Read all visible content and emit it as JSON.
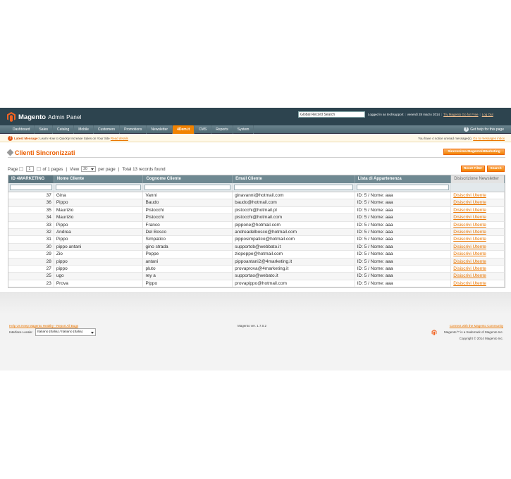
{
  "header": {
    "brand": "Magento",
    "subtitle": "Admin Panel",
    "search_value": "Global Record Search",
    "logged_in": "Logged in as techsupport",
    "date": "venerdì 28 marzo 2014",
    "try_go": "Try Magento Go for Free",
    "logout": "Log Out"
  },
  "nav": {
    "items": [
      {
        "label": "Dashboard"
      },
      {
        "label": "Sales"
      },
      {
        "label": "Catalog"
      },
      {
        "label": "Mobile"
      },
      {
        "label": "Customers"
      },
      {
        "label": "Promotions"
      },
      {
        "label": "Newsletter"
      },
      {
        "label": "4Dem.it"
      },
      {
        "label": "CMS"
      },
      {
        "label": "Reports"
      },
      {
        "label": "System"
      }
    ],
    "active_index": 7,
    "help": "Get help for this page"
  },
  "notice": {
    "latest_label": "Latest Message:",
    "latest_text": "Learn How to Quickly Increase Sales on Your Site",
    "read_details": "Read details",
    "right_text": "You have 4 notice unread message(s).",
    "go_messages": "Go to messages inbox"
  },
  "content": {
    "title": "Clienti Sincronizzati",
    "sync_button": "Sincronizza Magento/4Marketing"
  },
  "pager": {
    "page_label": "Page",
    "page_value": "1",
    "of_pages": "of 1 pages",
    "view_label": "View",
    "per_page_value": "20",
    "per_page_label": "per page",
    "total": "Total 13 records found",
    "reset_filter": "Reset Filter",
    "search": "Search"
  },
  "grid": {
    "columns": [
      "ID 4MARKETING",
      "Nome Cliente",
      "Cognome Cliente",
      "Email Cliente",
      "Lista di Appartenenza",
      "Disiscrizione Newsletter"
    ],
    "rows": [
      {
        "id": "37",
        "nome": "Gina",
        "cognome": "Vanni",
        "email": "ginavanni@hotmail.com",
        "lista": "ID: 5 / Nome: aaa",
        "action": "Disiscrivi Utente"
      },
      {
        "id": "36",
        "nome": "Pippo",
        "cognome": "Baudo",
        "email": "baudo@hotmail.com",
        "lista": "ID: 5 / Nome: aaa",
        "action": "Disiscrivi Utente"
      },
      {
        "id": "35",
        "nome": "Maurizio",
        "cognome": "Pistocchi",
        "email": "pistocchi@hotmail.pl",
        "lista": "ID: 5 / Nome: aaa",
        "action": "Disiscrivi Utente"
      },
      {
        "id": "34",
        "nome": "Maurizio",
        "cognome": "Pistocchi",
        "email": "pistocchi@hotmail.com",
        "lista": "ID: 5 / Nome: aaa",
        "action": "Disiscrivi Utente"
      },
      {
        "id": "33",
        "nome": "Pippo",
        "cognome": "Franco",
        "email": "pippone@hotmail.com",
        "lista": "ID: 5 / Nome: aaa",
        "action": "Disiscrivi Utente"
      },
      {
        "id": "32",
        "nome": "Andrea",
        "cognome": "Del Bosco",
        "email": "andreadelbosco@hotmail.com",
        "lista": "ID: 5 / Nome: aaa",
        "action": "Disiscrivi Utente"
      },
      {
        "id": "31",
        "nome": "Pippo",
        "cognome": "Simpatico",
        "email": "pipposimpatico@hotmail.com",
        "lista": "ID: 5 / Nome: aaa",
        "action": "Disiscrivi Utente"
      },
      {
        "id": "30",
        "nome": "pippo antani",
        "cognome": "gino strada",
        "email": "supportob@webbato.it",
        "lista": "ID: 5 / Nome: aaa",
        "action": "Disiscrivi Utente"
      },
      {
        "id": "29",
        "nome": "Zio",
        "cognome": "Peppe",
        "email": "ziopeppe@hotmail.com",
        "lista": "ID: 5 / Nome: aaa",
        "action": "Disiscrivi Utente"
      },
      {
        "id": "28",
        "nome": "pippo",
        "cognome": "antani",
        "email": "pippoantani2@4marketing.it",
        "lista": "ID: 5 / Nome: aaa",
        "action": "Disiscrivi Utente"
      },
      {
        "id": "27",
        "nome": "pippo",
        "cognome": "pluto",
        "email": "provaprova@4marketing.it",
        "lista": "ID: 5 / Nome: aaa",
        "action": "Disiscrivi Utente"
      },
      {
        "id": "25",
        "nome": "ugo",
        "cognome": "rey a",
        "email": "supportao@webato.it",
        "lista": "ID: 5 / Nome: aaa",
        "action": "Disiscrivi Utente"
      },
      {
        "id": "23",
        "nome": "Prova",
        "cognome": "Pippo",
        "email": "provapippo@hotmail.com",
        "lista": "ID: 5 / Nome: aaa",
        "action": "Disiscrivi Utente"
      }
    ]
  },
  "footer": {
    "help_us": "Help Us Keep Magento Healthy - Report All Bugs",
    "locale_label": "Interface Locale:",
    "locale_value": "Italiano (Italia) / Italiano (Italia)",
    "version": "Magento ver. 1.7.0.2",
    "community": "Connect with the Magento Community",
    "trademark": "Magento™ is a trademark of Magento Inc.",
    "copyright": "Copyright © 2014 Magento Inc."
  },
  "colors": {
    "accent": "#eb5e00",
    "header_bg": "#2d444f",
    "link": "#ea7601"
  }
}
